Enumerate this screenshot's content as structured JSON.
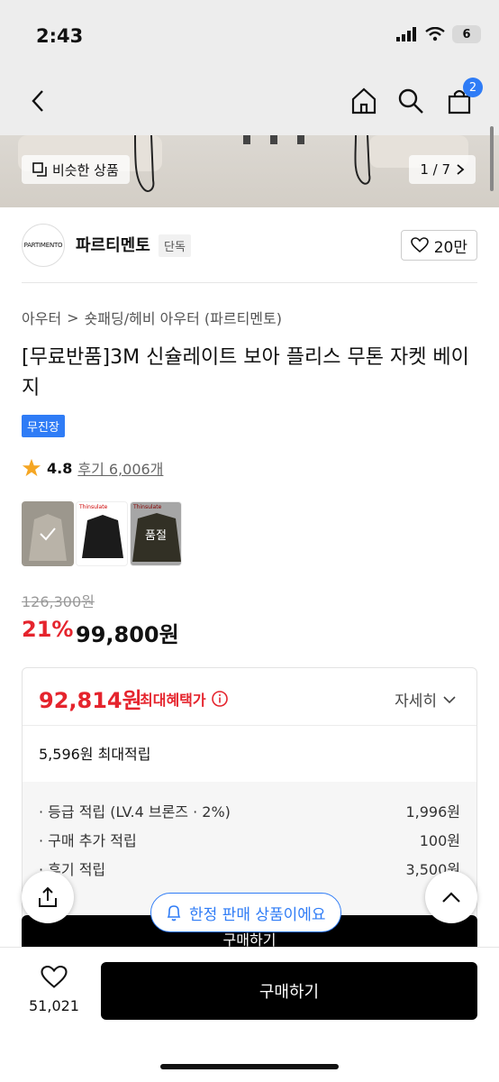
{
  "status": {
    "time": "2:43",
    "battery": "6"
  },
  "nav": {
    "cart_count": "2"
  },
  "gallery": {
    "similar_label": "비슷한 상품",
    "pager": "1 / 7"
  },
  "brand": {
    "logo_text": "PARTIMENTO",
    "name": "파르티멘토",
    "tag": "단독",
    "likes": "20만"
  },
  "breadcrumb": {
    "cat1": "아우터",
    "sep": ">",
    "cat2": "숏패딩/헤비 아우터 (파르티멘토)"
  },
  "product": {
    "title": "[무료반품]3M 신슐레이트 보아 플리스 무톤 자켓 베이지",
    "badge": "무진장",
    "rating": "4.8",
    "reviews": "후기 6,006개",
    "thumb_labels": {
      "t2_brand": "Thinsulate",
      "t3_brand": "Thinsulate",
      "t3_overlay": "품절"
    },
    "original_price": "126,300원",
    "discount": "21%",
    "price": "99,800원"
  },
  "benefit": {
    "max_price": "92,814원",
    "max_label": "최대혜택가",
    "detail": "자세히",
    "points": "5,596원 최대적립",
    "rows": [
      {
        "label": "· 등급 적립 (LV.4 브론즈 · 2%)",
        "value": "1,996원"
      },
      {
        "label": "· 구매 추가 적립",
        "value": "100원"
      },
      {
        "label": "· 후기 적립",
        "value": "3,500원"
      }
    ]
  },
  "overlay": {
    "limited": "한정 판매 상품이에요",
    "under_buy": "구매하기"
  },
  "bottom": {
    "wish_count": "51,021",
    "buy": "구매하기"
  },
  "colors": {
    "accent_blue": "#2f7cf6",
    "sale_red": "#e5242d"
  }
}
